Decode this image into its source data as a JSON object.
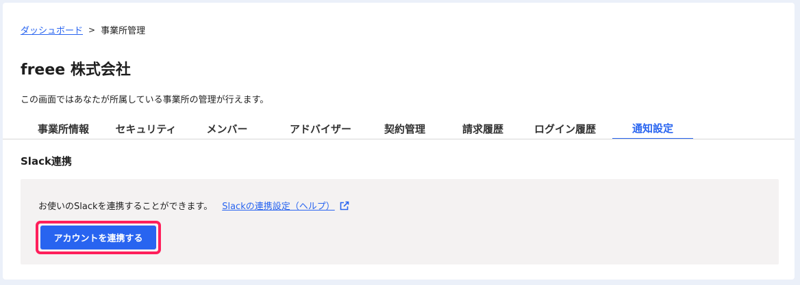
{
  "breadcrumb": {
    "parent": "ダッシュボード",
    "separator": ">",
    "current": "事業所管理"
  },
  "page": {
    "title": "freee 株式会社",
    "description": "この画面ではあなたが所属している事業所の管理が行えます。"
  },
  "tabs": [
    {
      "label": "事業所情報",
      "active": false
    },
    {
      "label": "セキュリティ",
      "active": false
    },
    {
      "label": "メンバー",
      "active": false
    },
    {
      "label": "アドバイザー",
      "active": false
    },
    {
      "label": "契約管理",
      "active": false
    },
    {
      "label": "請求履歴",
      "active": false
    },
    {
      "label": "ログイン履歴",
      "active": false
    },
    {
      "label": "通知設定",
      "active": true
    }
  ],
  "slack": {
    "section_title": "Slack連携",
    "text": "お使いのSlackを連携することができます。",
    "help_link": "Slackの連携設定（ヘルプ）",
    "help_icon": "external-link-icon",
    "connect_button": "アカウントを連携する"
  },
  "colors": {
    "accent": "#2864f0",
    "highlight": "#ff1f5b",
    "panel_bg": "#f4f2f2",
    "page_bg": "#ebf0f9"
  }
}
